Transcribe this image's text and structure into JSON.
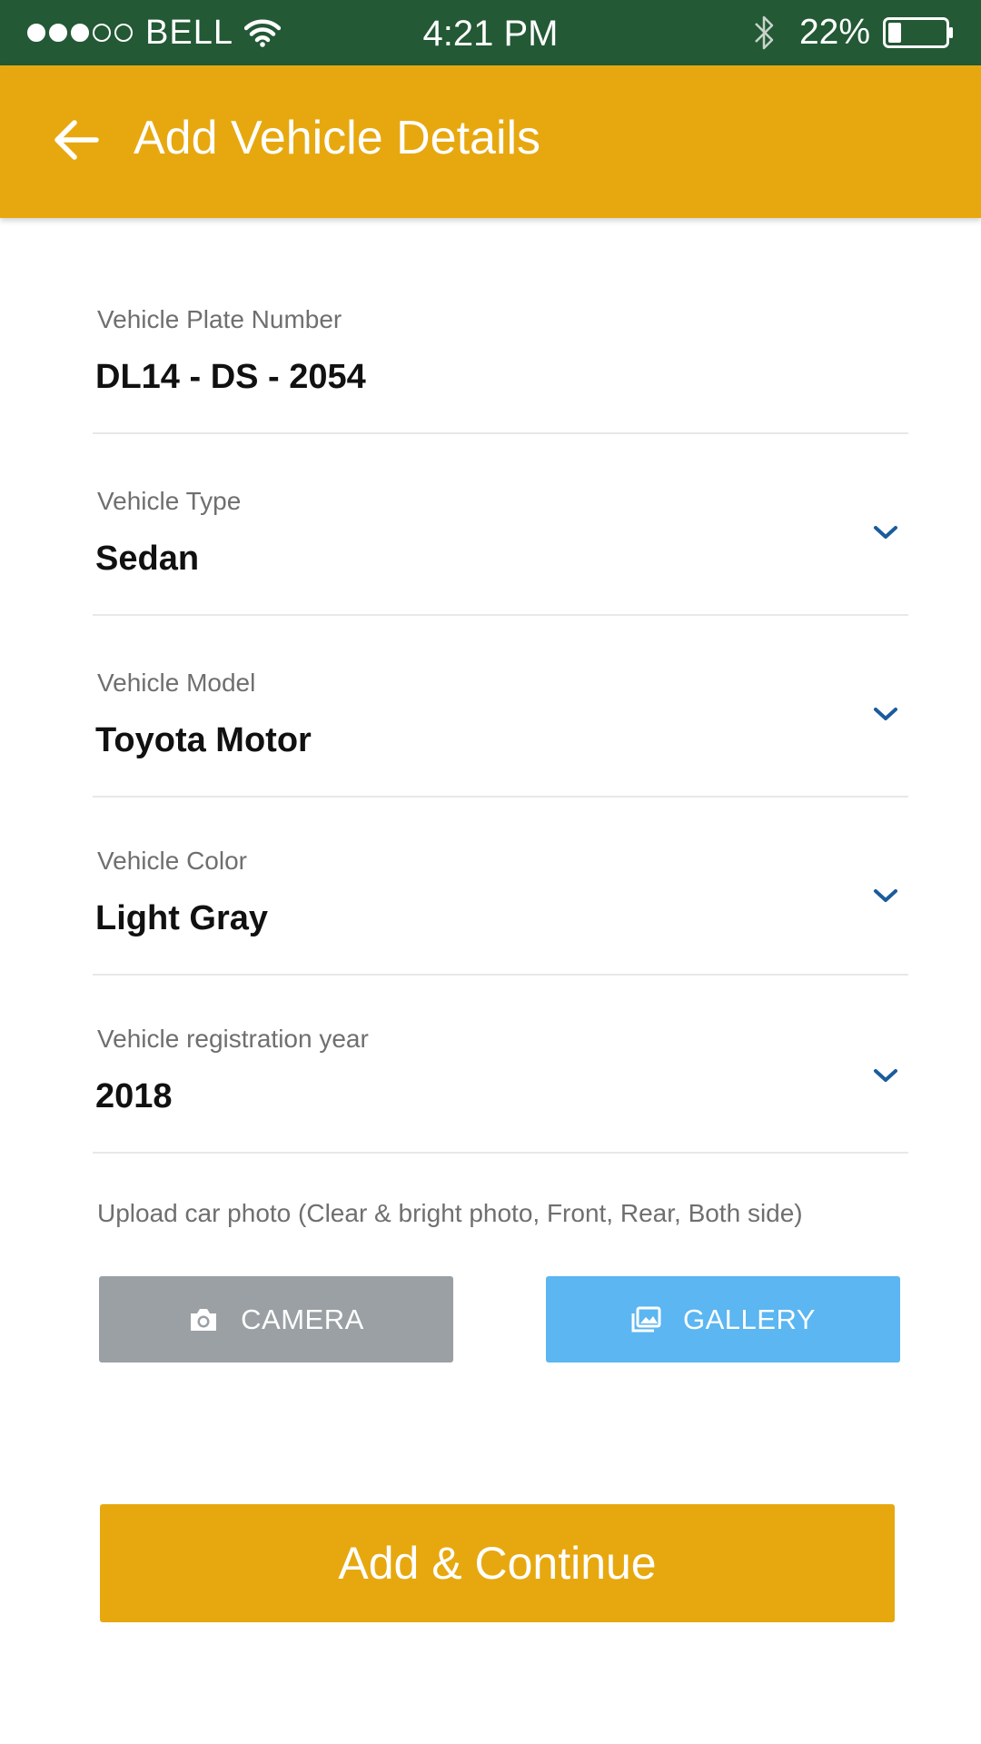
{
  "status_bar": {
    "carrier": "BELL",
    "signal_bars_filled": 3,
    "signal_bars_total": 5,
    "time": "4:21 PM",
    "battery": "22%",
    "icons": [
      "wifi-icon",
      "bluetooth-icon",
      "battery-icon"
    ]
  },
  "app_bar": {
    "title": "Add Vehicle Details",
    "back_icon": "arrow-left-icon"
  },
  "form": {
    "plate": {
      "label": "Vehicle Plate Number",
      "value": "DL14 - DS - 2054"
    },
    "type": {
      "label": "Vehicle Type",
      "value": "Sedan"
    },
    "model": {
      "label": "Vehicle Model",
      "value": "Toyota Motor"
    },
    "color": {
      "label": "Vehicle Color",
      "value": "Light Gray"
    },
    "year": {
      "label": "Vehicle registration year",
      "value": "2018"
    }
  },
  "upload": {
    "hint": "Upload car photo (Clear & bright photo, Front, Rear, Both side)",
    "camera_label": "CAMERA",
    "gallery_label": "GALLERY"
  },
  "primary_button": {
    "label": "Add & Continue"
  },
  "colors": {
    "status_bar": "#235935",
    "app_bar": "#e7a80f",
    "camera_button": "#9aa0a3",
    "gallery_button": "#5bb6f1",
    "primary_button": "#e7a80f",
    "chevron": "#1a5c9c"
  }
}
